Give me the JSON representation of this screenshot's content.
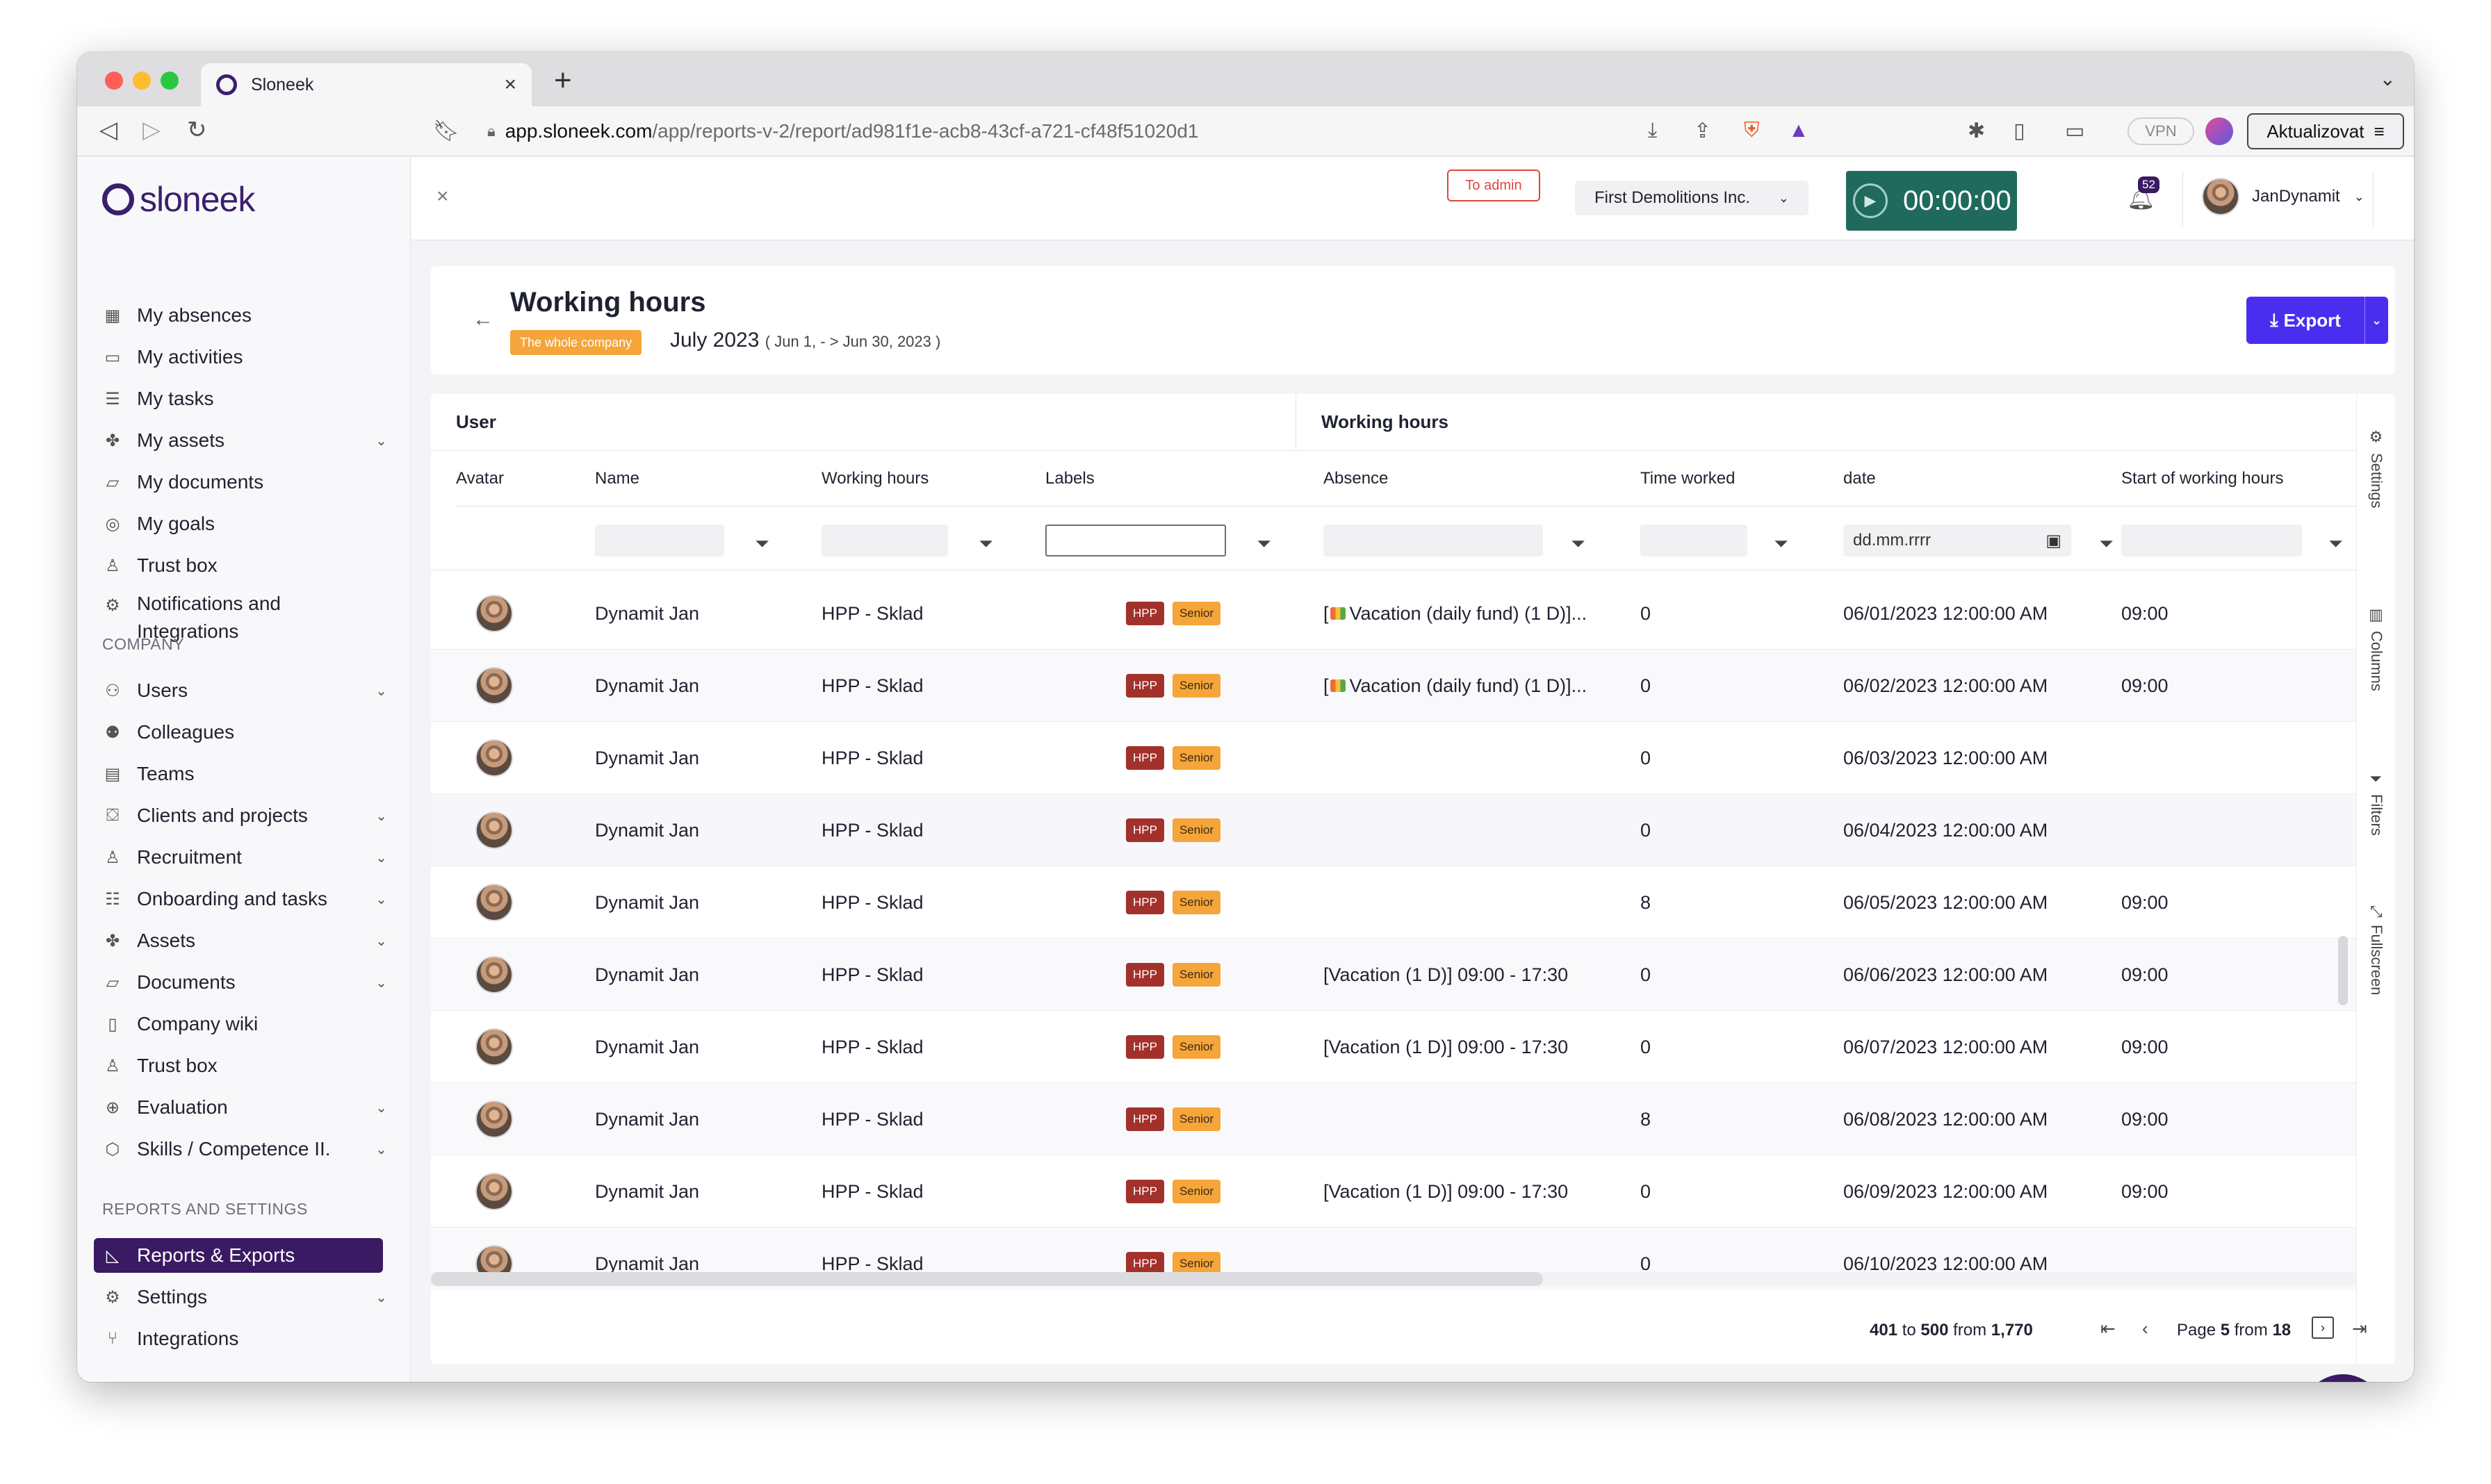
{
  "browser": {
    "tab_title": "Sloneek",
    "url_host": "app.sloneek.com",
    "url_path": "/app/reports-v-2/report/ad981f1e-acb8-43cf-a721-cf48f51020d1",
    "vpn_label": "VPN",
    "update_button": "Aktualizovat",
    "traffic_light_colors": [
      "#ff5f57",
      "#febc2e",
      "#28c840"
    ]
  },
  "sidebar": {
    "logo": "sloneek",
    "personal_items": [
      {
        "label": "My absences",
        "icon": "calendar-x-icon"
      },
      {
        "label": "My activities",
        "icon": "book-icon"
      },
      {
        "label": "My tasks",
        "icon": "list-icon"
      },
      {
        "label": "My assets",
        "icon": "assets-icon",
        "chevron": true
      },
      {
        "label": "My documents",
        "icon": "folder-icon"
      },
      {
        "label": "My goals",
        "icon": "target-icon"
      },
      {
        "label": "Trust box",
        "icon": "trust-box-icon"
      },
      {
        "label": "Notifications and",
        "label2": "Integrations",
        "icon": "gear-icon"
      }
    ],
    "company_heading": "COMPANY",
    "company_items": [
      {
        "label": "Users",
        "icon": "users-icon",
        "chevron": true
      },
      {
        "label": "Colleagues",
        "icon": "colleagues-icon"
      },
      {
        "label": "Teams",
        "icon": "teams-icon"
      },
      {
        "label": "Clients and projects",
        "icon": "clients-icon",
        "chevron": true
      },
      {
        "label": "Recruitment",
        "icon": "recruitment-icon",
        "chevron": true
      },
      {
        "label": "Onboarding and tasks",
        "icon": "onboarding-icon",
        "chevron": true
      },
      {
        "label": "Assets",
        "icon": "assets-icon",
        "chevron": true
      },
      {
        "label": "Documents",
        "icon": "folder-icon",
        "chevron": true
      },
      {
        "label": "Company wiki",
        "icon": "wiki-icon"
      },
      {
        "label": "Trust box",
        "icon": "trust-box-icon"
      },
      {
        "label": "Evaluation",
        "icon": "evaluation-icon",
        "chevron": true
      },
      {
        "label": "Skills / Competence II.",
        "icon": "skills-icon",
        "chevron": true
      }
    ],
    "reports_heading": "REPORTS AND SETTINGS",
    "reports_items": [
      {
        "label": "Reports & Exports",
        "icon": "chart-icon",
        "active": true
      },
      {
        "label": "Settings",
        "icon": "gear-icon",
        "chevron": true
      },
      {
        "label": "Integrations",
        "icon": "integrations-icon"
      }
    ],
    "active_bg": "#3a1a63"
  },
  "header": {
    "to_admin": "To admin",
    "company": "First Demolitions Inc.",
    "timer": "00:00:00",
    "notifications_count": "52",
    "user_name": "JanDynamit"
  },
  "report": {
    "title": "Working hours",
    "scope_badge": "The whole company",
    "period": "July 2023",
    "range": "( Jun 1, - > Jun 30, 2023 )",
    "export_label": "Export"
  },
  "grid": {
    "group_user": "User",
    "group_working_hours": "Working hours",
    "columns": [
      "Avatar",
      "Name",
      "Working hours",
      "Labels",
      "Absence",
      "Time worked",
      "date",
      "Start of working hours"
    ],
    "date_placeholder": "dd.mm.rrrr",
    "label_hpp": "HPP",
    "label_senior": "Senior",
    "rows": [
      {
        "name": "Dynamit Jan",
        "working_hours": "HPP - Sklad",
        "absence": "Vacation (daily fund) (1 D)]...",
        "absence_icon": true,
        "time_worked": "0",
        "date": "06/01/2023 12:00:00 AM",
        "start": "09:00"
      },
      {
        "name": "Dynamit Jan",
        "working_hours": "HPP - Sklad",
        "absence": "Vacation (daily fund) (1 D)]...",
        "absence_icon": true,
        "time_worked": "0",
        "date": "06/02/2023 12:00:00 AM",
        "start": "09:00"
      },
      {
        "name": "Dynamit Jan",
        "working_hours": "HPP - Sklad",
        "absence": "",
        "absence_icon": false,
        "time_worked": "0",
        "date": "06/03/2023 12:00:00 AM",
        "start": ""
      },
      {
        "name": "Dynamit Jan",
        "working_hours": "HPP - Sklad",
        "absence": "",
        "absence_icon": false,
        "time_worked": "0",
        "date": "06/04/2023 12:00:00 AM",
        "start": ""
      },
      {
        "name": "Dynamit Jan",
        "working_hours": "HPP - Sklad",
        "absence": "",
        "absence_icon": false,
        "time_worked": "8",
        "date": "06/05/2023 12:00:00 AM",
        "start": "09:00"
      },
      {
        "name": "Dynamit Jan",
        "working_hours": "HPP - Sklad",
        "absence": "[Vacation (1 D)] 09:00 - 17:30",
        "absence_icon": false,
        "time_worked": "0",
        "date": "06/06/2023 12:00:00 AM",
        "start": "09:00"
      },
      {
        "name": "Dynamit Jan",
        "working_hours": "HPP - Sklad",
        "absence": "[Vacation (1 D)] 09:00 - 17:30",
        "absence_icon": false,
        "time_worked": "0",
        "date": "06/07/2023 12:00:00 AM",
        "start": "09:00"
      },
      {
        "name": "Dynamit Jan",
        "working_hours": "HPP - Sklad",
        "absence": "",
        "absence_icon": false,
        "time_worked": "8",
        "date": "06/08/2023 12:00:00 AM",
        "start": "09:00"
      },
      {
        "name": "Dynamit Jan",
        "working_hours": "HPP - Sklad",
        "absence": "[Vacation (1 D)] 09:00 - 17:30",
        "absence_icon": false,
        "time_worked": "0",
        "date": "06/09/2023 12:00:00 AM",
        "start": "09:00"
      },
      {
        "name": "Dynamit Jan",
        "working_hours": "HPP - Sklad",
        "absence": "",
        "absence_icon": false,
        "time_worked": "0",
        "date": "06/10/2023 12:00:00 AM",
        "start": ""
      }
    ]
  },
  "side_tabs": [
    "Settings",
    "Columns",
    "Filters",
    "Fullscreen"
  ],
  "pagination": {
    "from": "401",
    "to_word": "to",
    "to": "500",
    "from_word": "from",
    "total": "1,770",
    "page_word": "Page",
    "page": "5",
    "of_word": "from",
    "pages": "18"
  },
  "help_label": "?",
  "colors": {
    "brand": "#3a1a63",
    "export": "#4a2ef0",
    "timer": "#1f6a5c",
    "hpp": "#a3312b",
    "senior": "#f5a53a",
    "to_admin": "#e0453d"
  }
}
